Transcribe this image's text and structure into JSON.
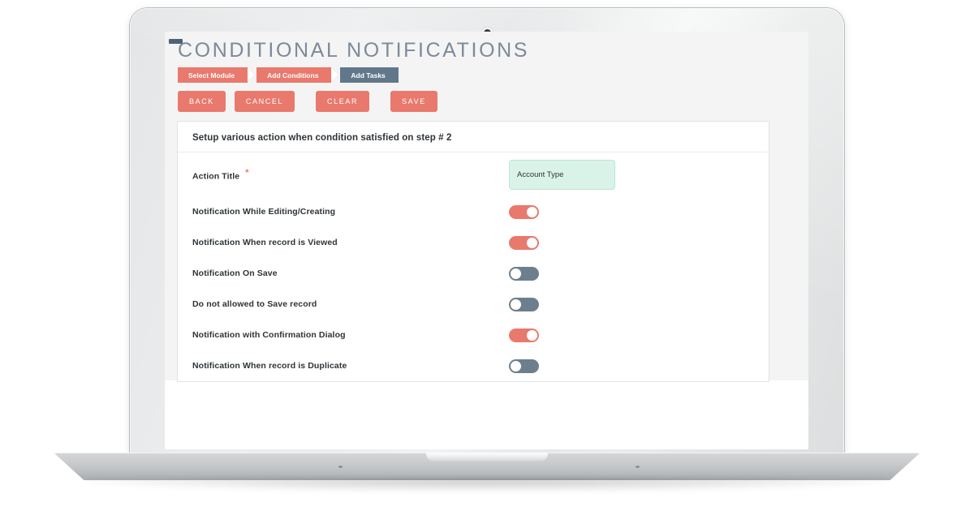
{
  "page": {
    "title": "CONDITIONAL NOTIFICATIONS",
    "accent_color": "#e9796d",
    "active_step_color": "#61788a",
    "toggle_off_color": "#6d7f8d",
    "input_fill_color": "#d9f3e9",
    "background_color": "#f4f4f4"
  },
  "steps": [
    {
      "label": "Select Module",
      "state": "done",
      "color": "#e9796d"
    },
    {
      "label": "Add Conditions",
      "state": "done",
      "color": "#e9796d"
    },
    {
      "label": "Add Tasks",
      "state": "active",
      "color": "#61788a"
    }
  ],
  "toolbar": {
    "buttons": [
      {
        "label": "BACK"
      },
      {
        "label": "CANCEL"
      },
      {
        "label": "CLEAR"
      },
      {
        "label": "SAVE"
      }
    ]
  },
  "panel": {
    "heading": "Setup various action when condition satisfied on step # 2",
    "action_title": {
      "label": "Action Title",
      "required_marker": "*",
      "value": "Account Type",
      "placeholder": "Action Title"
    },
    "toggles": [
      {
        "label": "Notification While Editing/Creating",
        "state": "on"
      },
      {
        "label": "Notification When record is Viewed",
        "state": "on"
      },
      {
        "label": "Notification On Save",
        "state": "off"
      },
      {
        "label": "Do not allowed to Save record",
        "state": "off"
      },
      {
        "label": "Notification with Confirmation Dialog",
        "state": "on"
      },
      {
        "label": "Notification When record is Duplicate",
        "state": "off"
      }
    ]
  }
}
